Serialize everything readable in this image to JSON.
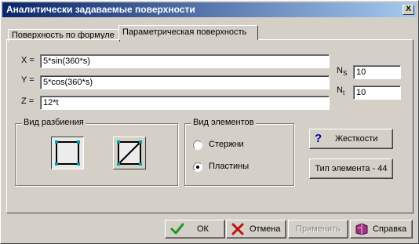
{
  "window": {
    "title": "Аналитически задаваемые поверхности",
    "close_label": "X"
  },
  "tabs": [
    {
      "label": "Поверхность по формуле",
      "active": false
    },
    {
      "label": "Параметрическая поверхность",
      "active": true
    }
  ],
  "formulas": {
    "x_label": "X =",
    "x_value": "5*sin(360*s)",
    "y_label": "Y =",
    "y_value": "5*cos(360*s)",
    "z_label": "Z =",
    "z_value": "12*t"
  },
  "params": {
    "ns_label": "N",
    "ns_sub": "S",
    "ns_value": "10",
    "nt_label": "N",
    "nt_sub": "t",
    "nt_value": "10"
  },
  "split_group": {
    "title": "Вид разбиения"
  },
  "elements_group": {
    "title": "Вид элементов",
    "options": [
      {
        "label": "Стержни",
        "selected": false
      },
      {
        "label": "Пластины",
        "selected": true
      }
    ]
  },
  "right_buttons": {
    "stiffness": "Жесткости",
    "element_type": "Тип элемента - 44"
  },
  "footer": {
    "ok": "ОК",
    "cancel": "Отмена",
    "apply": "Применить",
    "help": "Справка"
  },
  "colors": {
    "title_start": "#0a246a",
    "title_end": "#a6caf0",
    "marker": "#00a0a0",
    "face": "#d4d0c8"
  }
}
